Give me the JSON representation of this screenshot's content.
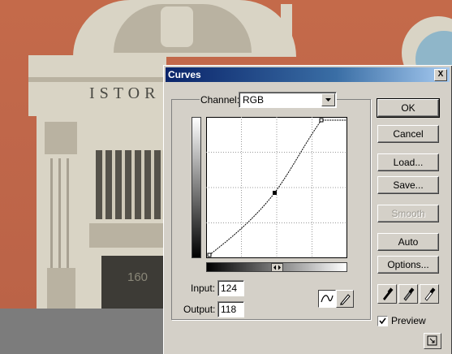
{
  "dialog": {
    "title": "Curves",
    "close_glyph": "X",
    "channel_label": "Channel:",
    "channel_value": "RGB",
    "buttons": {
      "ok": "OK",
      "cancel": "Cancel",
      "load": "Load...",
      "save": "Save...",
      "smooth": "Smooth",
      "auto": "Auto",
      "options": "Options..."
    },
    "input_label": "Input:",
    "input_value": "124",
    "output_label": "Output:",
    "output_value": "118",
    "preview_label": "Preview",
    "preview_checked": true,
    "curve_tools": [
      "curve-point-tool",
      "pencil-tool"
    ],
    "eyedroppers": [
      "black-eyedropper",
      "gray-eyedropper",
      "white-eyedropper"
    ]
  },
  "background": {
    "building_letters": "ISTOR",
    "door_number": "160"
  },
  "colors": {
    "titlebar_start": "#0a246a",
    "titlebar_end": "#a6caf0",
    "dialog_face": "#d4d0c8",
    "wall": "#c46a4a"
  }
}
